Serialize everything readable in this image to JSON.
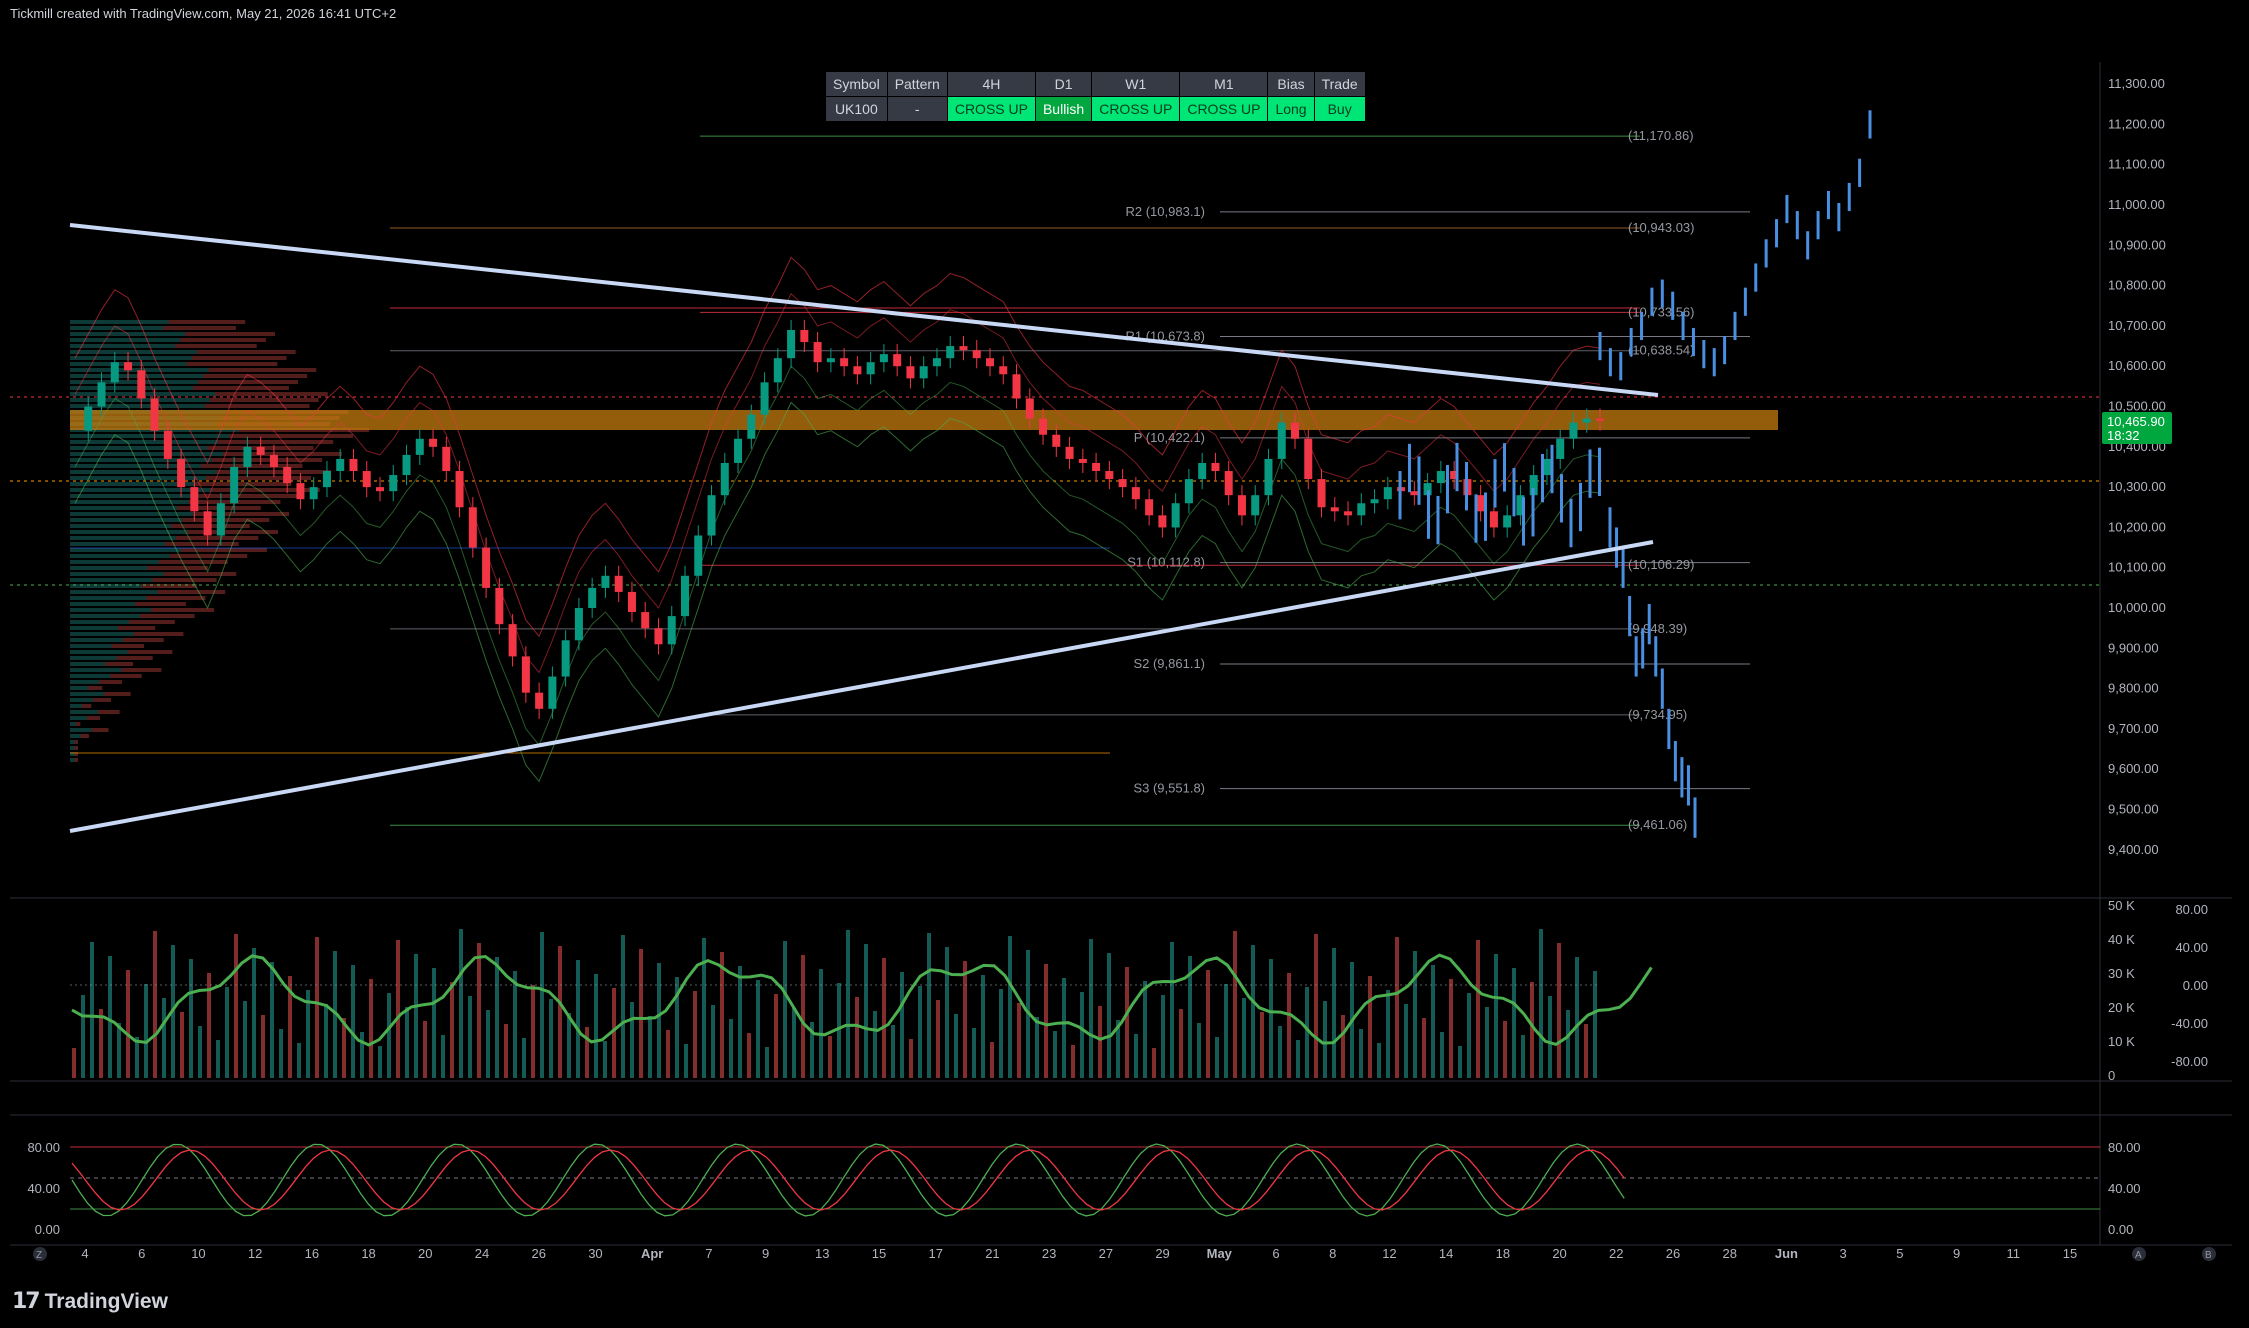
{
  "header": {
    "text": "Tickmill created with TradingView.com, May 21, 2026 16:41 UTC+2"
  },
  "footer": {
    "logo_mark": "17",
    "logo_text": "TradingView"
  },
  "table": {
    "headers": [
      "Symbol",
      "Pattern",
      "4H",
      "D1",
      "W1",
      "M1",
      "Bias",
      "Trade"
    ],
    "values": [
      "UK100",
      "-",
      "CROSS UP",
      "Bullish",
      "CROSS UP",
      "CROSS UP",
      "Long",
      "Buy"
    ]
  },
  "price_badge": {
    "price": "10,465.90",
    "countdown": "18:32"
  },
  "colors": {
    "up": "#26a69a",
    "down": "#ef5350",
    "green": "#4caf50",
    "red": "#f23645",
    "projection": "#4a90e2",
    "trendline": "#c9d8f5",
    "zone": "#c67c0f"
  },
  "chart_data": {
    "type": "line",
    "title": "",
    "symbol": "UK100",
    "ylim": [
      9350,
      11340
    ],
    "y_ticks": [
      "11,300.00",
      "11,200.00",
      "11,100.00",
      "11,000.00",
      "10,900.00",
      "10,800.00",
      "10,700.00",
      "10,600.00",
      "10,500.00",
      "10,400.00",
      "10,300.00",
      "10,200.00",
      "10,100.00",
      "10,000.00",
      "9,900.00",
      "9,800.00",
      "9,700.00",
      "9,600.00",
      "9,500.00",
      "9,400.00"
    ],
    "x_ticks": [
      "4",
      "6",
      "10",
      "12",
      "16",
      "18",
      "20",
      "24",
      "26",
      "30",
      "Apr",
      "7",
      "9",
      "13",
      "15",
      "17",
      "21",
      "23",
      "27",
      "29",
      "May",
      "6",
      "8",
      "12",
      "14",
      "18",
      "20",
      "22",
      "26",
      "28",
      "Jun",
      "3",
      "5",
      "9",
      "11",
      "15"
    ],
    "pivot_levels": [
      {
        "label": "R2 (10,983.1)",
        "value": 10983.1
      },
      {
        "label": "R1 (10,673.8)",
        "value": 10673.8
      },
      {
        "label": "P (10,422.1)",
        "value": 10422.1
      },
      {
        "label": "S1 (10,112.8)",
        "value": 10112.8
      },
      {
        "label": "S2 (9,861.1)",
        "value": 9861.1
      },
      {
        "label": "S3 (9,551.8)",
        "value": 9551.8
      }
    ],
    "fib_levels": [
      {
        "label": "(11,170.86)",
        "value": 11170.86
      },
      {
        "label": "(10,943.03)",
        "value": 10943.03
      },
      {
        "label": "(10,733.56)",
        "value": 10733.56
      },
      {
        "label": "(10,638.54)",
        "value": 10638.54
      },
      {
        "label": "(10,106.29)",
        "value": 10106.29
      },
      {
        "label": "(9,948.39)",
        "value": 9948.39
      },
      {
        "label": "(9,734.95)",
        "value": 9734.95
      },
      {
        "label": "(9,461.06)",
        "value": 9461.06
      }
    ],
    "price_series": {
      "name": "UK100",
      "values": [
        10440,
        10500,
        10560,
        10610,
        10590,
        10520,
        10440,
        10370,
        10300,
        10240,
        10180,
        10260,
        10350,
        10400,
        10380,
        10350,
        10310,
        10270,
        10300,
        10340,
        10370,
        10340,
        10300,
        10290,
        10330,
        10380,
        10420,
        10400,
        10340,
        10250,
        10150,
        10050,
        9960,
        9880,
        9790,
        9750,
        9830,
        9920,
        10000,
        10050,
        10080,
        10040,
        9990,
        9950,
        9910,
        9980,
        10080,
        10180,
        10280,
        10360,
        10420,
        10480,
        10560,
        10620,
        10690,
        10660,
        10610,
        10620,
        10600,
        10580,
        10610,
        10630,
        10600,
        10570,
        10600,
        10620,
        10650,
        10640,
        10620,
        10600,
        10580,
        10520,
        10470,
        10430,
        10400,
        10370,
        10360,
        10340,
        10320,
        10300,
        10270,
        10230,
        10200,
        10260,
        10320,
        10360,
        10340,
        10280,
        10230,
        10280,
        10370,
        10460,
        10420,
        10320,
        10250,
        10240,
        10230,
        10260,
        10270,
        10300,
        10290,
        10280,
        10310,
        10340,
        10320,
        10280,
        10240,
        10200,
        10230,
        10280,
        10330,
        10370,
        10420,
        10460,
        10470,
        10465
      ]
    },
    "projection_series": {
      "name": "projection",
      "values": [
        10650,
        10610,
        10600,
        10660,
        10700,
        10760,
        10780,
        10750,
        10700,
        10660,
        10630,
        10610,
        10640,
        10700,
        10760,
        10820,
        10880,
        10930,
        10990,
        10950,
        10900,
        10950,
        11000,
        10970,
        11020,
        11080,
        11200
      ]
    },
    "drop_series": {
      "name": "drop",
      "values": [
        10200,
        10150,
        10100,
        9980,
        9880,
        9900,
        9960,
        9880,
        9800,
        9700,
        9620,
        9580,
        9560,
        9480
      ]
    },
    "volume_axis": [
      "50 K",
      "40 K",
      "30 K",
      "20 K",
      "10 K",
      "0"
    ],
    "oscillator_axis": [
      "80.00",
      "40.00",
      "0.00",
      "-40.00",
      "-80.00"
    ],
    "stoch_axis": [
      "80.00",
      "40.00",
      "0.00"
    ]
  }
}
